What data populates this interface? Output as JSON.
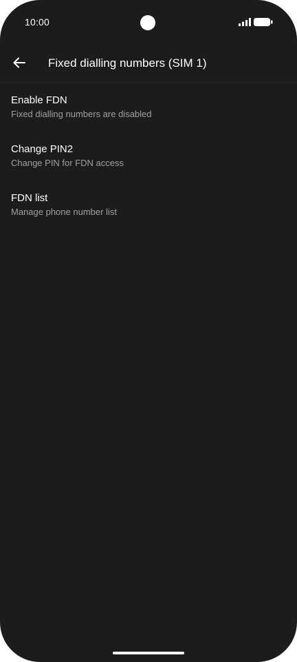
{
  "status_bar": {
    "time": "10:00"
  },
  "app_bar": {
    "back_icon": "arrow-back-icon",
    "title": "Fixed dialling numbers (SIM 1)"
  },
  "settings": {
    "items": [
      {
        "title": "Enable FDN",
        "subtitle": "Fixed dialling numbers are disabled"
      },
      {
        "title": "Change PIN2",
        "subtitle": "Change PIN for FDN access"
      },
      {
        "title": "FDN list",
        "subtitle": "Manage phone number list"
      }
    ]
  },
  "colors": {
    "background": "#1c1c1c",
    "primary_text": "#ffffff",
    "secondary_text": "#a0a0a0"
  }
}
